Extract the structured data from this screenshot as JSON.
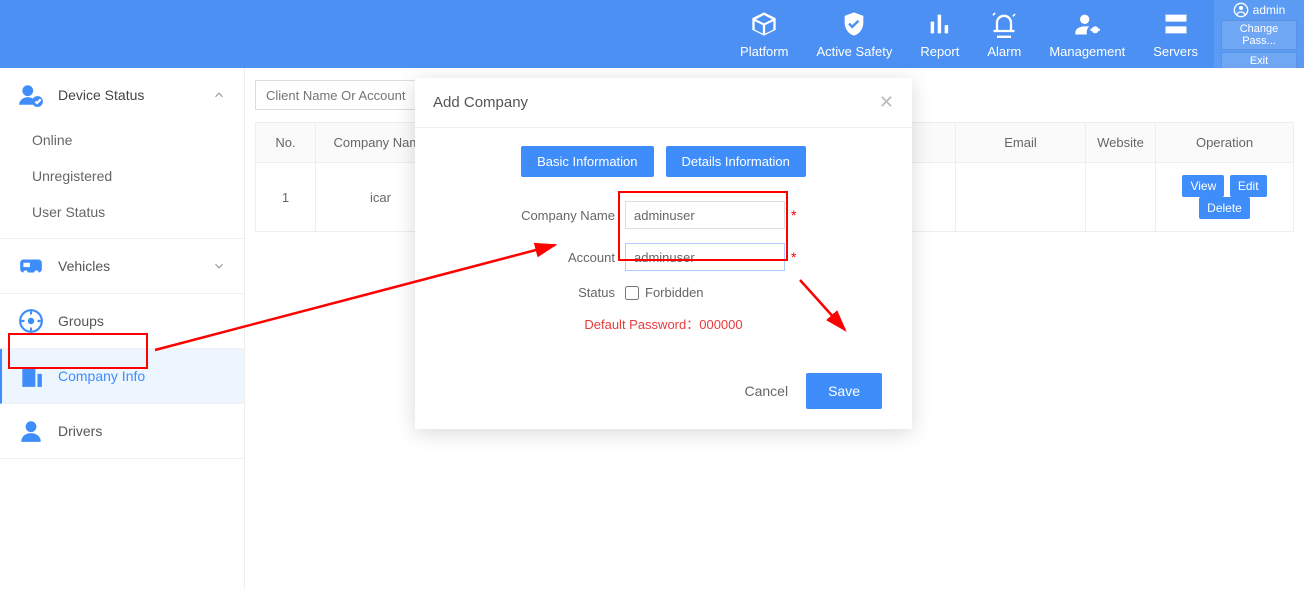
{
  "user": {
    "name": "admin",
    "changePass": "Change Pass...",
    "exit": "Exit"
  },
  "nav": {
    "platform": "Platform",
    "activeSafety": "Active Safety",
    "report": "Report",
    "alarm": "Alarm",
    "management": "Management",
    "servers": "Servers"
  },
  "sidebar": {
    "deviceStatus": "Device Status",
    "online": "Online",
    "unregistered": "Unregistered",
    "userStatus": "User Status",
    "vehicles": "Vehicles",
    "groups": "Groups",
    "companyInfo": "Company Info",
    "drivers": "Drivers"
  },
  "search": {
    "placeholder": "Client Name Or Account"
  },
  "table": {
    "headers": {
      "no": "No.",
      "companyName": "Company Name",
      "email": "Email",
      "website": "Website",
      "operation": "Operation"
    },
    "row1": {
      "no": "1",
      "name": "icar"
    },
    "ops": {
      "view": "View",
      "edit": "Edit",
      "delete": "Delete"
    }
  },
  "modal": {
    "title": "Add Company",
    "tabs": {
      "basic": "Basic Information",
      "details": "Details Information"
    },
    "labels": {
      "companyName": "Company Name",
      "account": "Account",
      "status": "Status",
      "forbidden": "Forbidden"
    },
    "values": {
      "companyName": "adminuser",
      "account": "adminuser"
    },
    "defaultPassword": "Default Password：000000",
    "cancel": "Cancel",
    "save": "Save"
  }
}
